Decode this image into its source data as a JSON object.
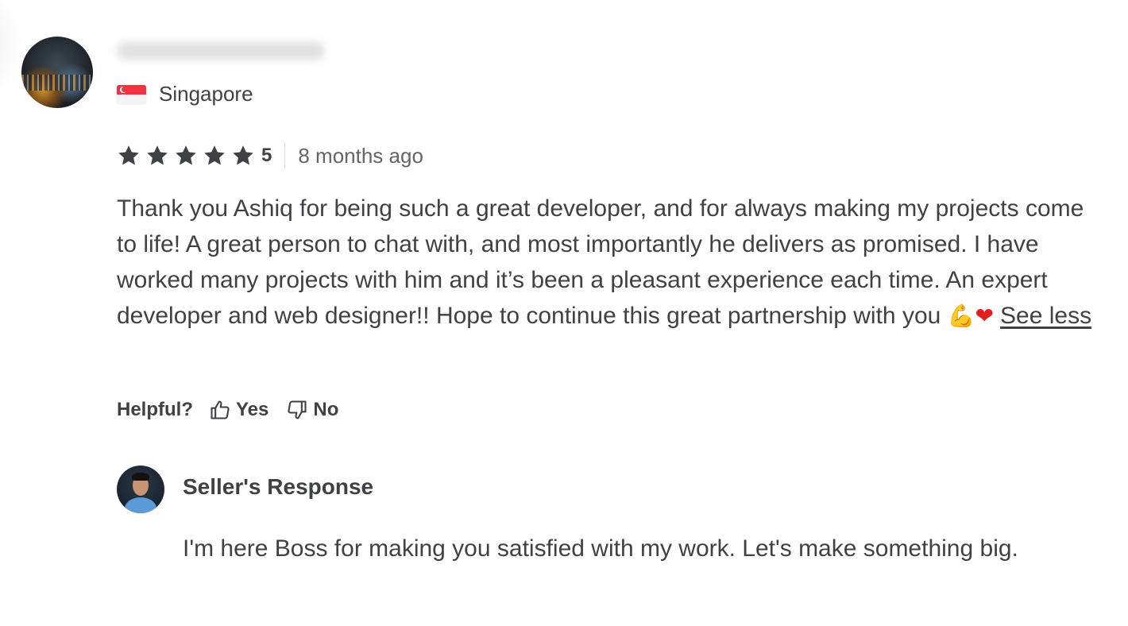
{
  "reviewer": {
    "country": "Singapore",
    "flag_icon": "singapore-flag-icon"
  },
  "rating": {
    "stars": 5,
    "value": "5",
    "time_ago": "8 months ago",
    "star_color": "#404145"
  },
  "review": {
    "text": "Thank you Ashiq for being such a great developer, and for always making my projects come to life! A great person to chat with, and most importantly he delivers as promised. I have worked many projects with him and it’s been a pleasant experience each time. An expert developer and web designer!! Hope to continue this great partnership with you",
    "emoji_1": "💪",
    "emoji_2": "❤",
    "see_less_label": "See less"
  },
  "helpful": {
    "label": "Helpful?",
    "yes_label": "Yes",
    "no_label": "No"
  },
  "seller_response": {
    "title": "Seller's Response",
    "text": "I'm here Boss for making you satisfied with my work. Let's make something big."
  }
}
